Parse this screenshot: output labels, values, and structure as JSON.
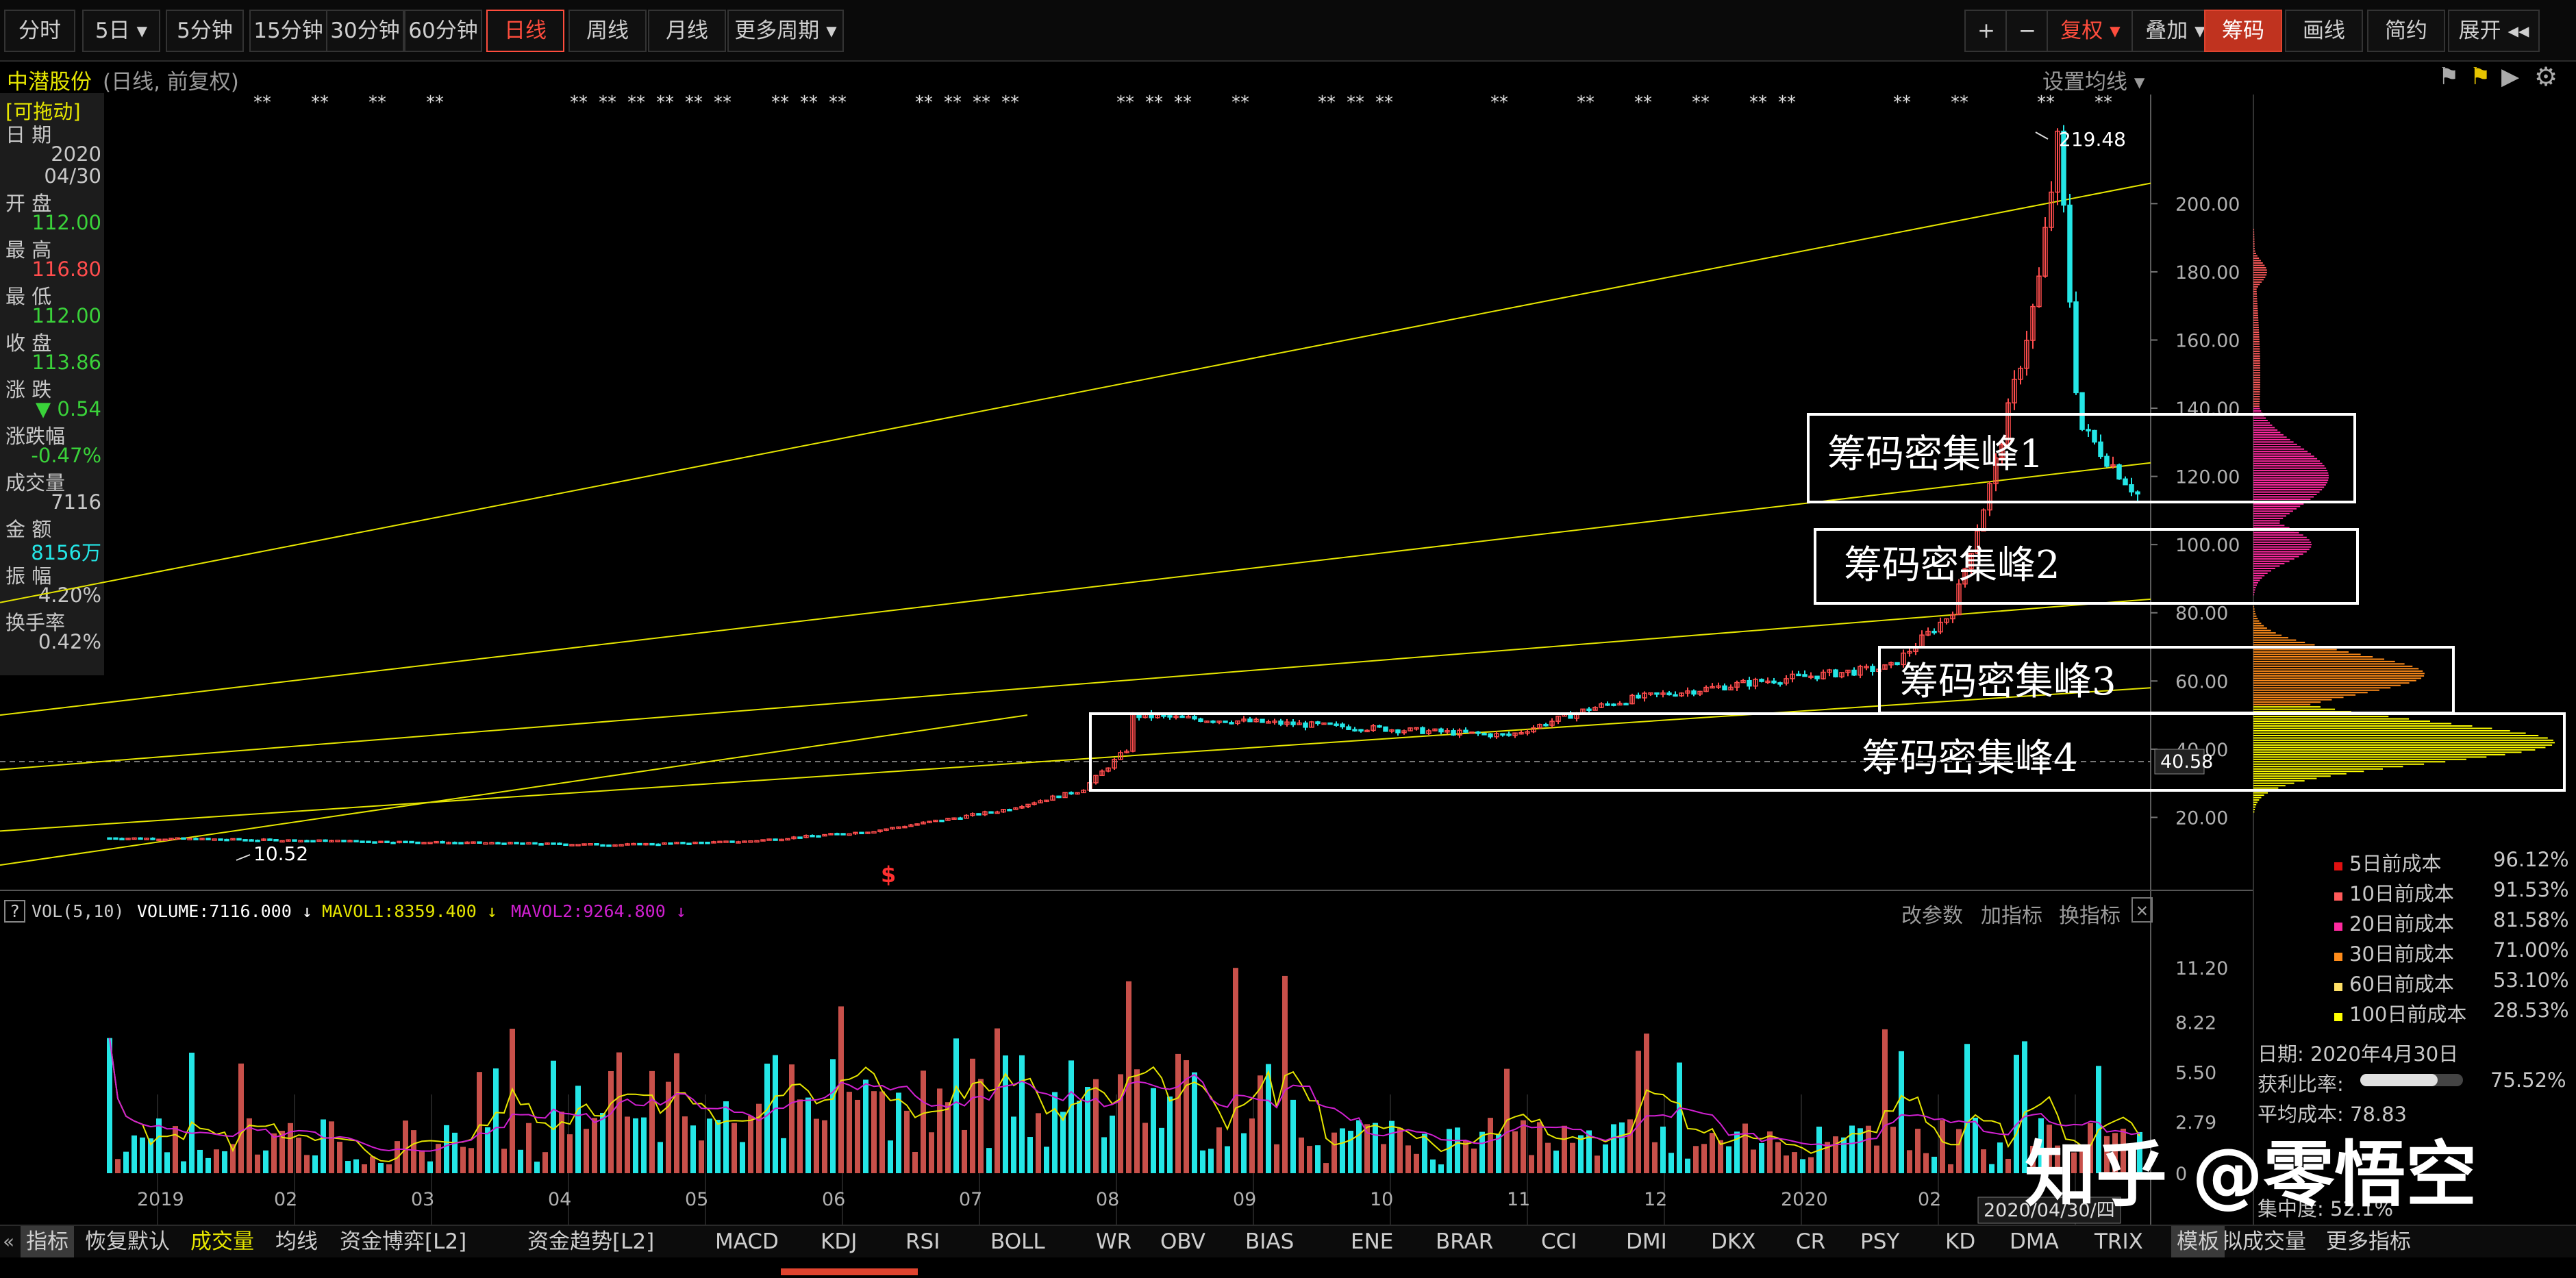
{
  "toolbar": {
    "left_tabs": [
      "分时",
      "5日 ▾",
      "5分钟",
      "15分钟",
      "30分钟",
      "60分钟",
      "日线",
      "周线",
      "月线",
      "更多周期 ▾"
    ],
    "right_tabs": [
      "+",
      "−",
      "复权 ▾",
      "叠加 ▾",
      "筹码",
      "画线",
      "简约",
      "展开 ◂◂"
    ]
  },
  "header": {
    "stock_name": "中潜股份",
    "mode": "(日线, 前复权)",
    "ma_settings": "设置均线 ▾"
  },
  "info_panel": [
    {
      "label": "[可拖动]",
      "value": ""
    },
    {
      "label": "日  期",
      "value": "2020"
    },
    {
      "label": "",
      "value": "04/30"
    },
    {
      "label": "开  盘",
      "value": "112.00"
    },
    {
      "label": "最  高",
      "value": "116.80"
    },
    {
      "label": "最  低",
      "value": "112.00"
    },
    {
      "label": "收  盘",
      "value": "113.86"
    },
    {
      "label": "涨  跌",
      "value": "▼ 0.54"
    },
    {
      "label": "涨跌幅",
      "value": "-0.47%"
    },
    {
      "label": "成交量",
      "value": "7116"
    },
    {
      "label": "金  额",
      "value": "8156万"
    },
    {
      "label": "振  幅",
      "value": "4.20%"
    },
    {
      "label": "换手率",
      "value": "0.42%"
    }
  ],
  "annotations": {
    "peaks": [
      "筹码密集峰1",
      "筹码密集峰2",
      "筹码密集峰3",
      "筹码密集峰4"
    ],
    "high_label": "219.48",
    "low_label": "10.52",
    "current_price": "40.58",
    "signal_marker": "$"
  },
  "volume_header": {
    "title": "VOL(5,10)",
    "volume": "VOLUME:7116.000 ↓",
    "mavol1": "MAVOL1:8359.400 ↓",
    "mavol2": "MAVOL2:9264.800 ↓",
    "actions": [
      "改参数",
      "加指标",
      "换指标"
    ]
  },
  "date_cursor": "2020/04/30/四",
  "watermark": "知乎 @零悟空",
  "cost_legend": [
    {
      "label": "5日前成本",
      "value": "96.12%",
      "color": "#e01010"
    },
    {
      "label": "10日前成本",
      "value": "91.53%",
      "color": "#ff5a5a"
    },
    {
      "label": "20日前成本",
      "value": "81.58%",
      "color": "#ff2aa0"
    },
    {
      "label": "30日前成本",
      "value": "71.00%",
      "color": "#ff8c1a"
    },
    {
      "label": "60日前成本",
      "value": "53.10%",
      "color": "#ffe066"
    },
    {
      "label": "100日前成本",
      "value": "28.53%",
      "color": "#ffff00"
    }
  ],
  "chip_summary": {
    "date": "日期: 2020年4月30日",
    "profit_label": "获利比率:",
    "profit_value": "75.52%",
    "avg_cost": "平均成本: 78.83",
    "concentration": "集中度: 52.1%"
  },
  "bottom_tabs": [
    "指标",
    "恢复默认",
    "成交量",
    "均线",
    "资金博弈[L2]",
    "资金趋势[L2]",
    "MACD",
    "KDJ",
    "RSI",
    "BOLL",
    "WR",
    "OBV",
    "BIAS",
    "ENE",
    "BRAR",
    "CCI",
    "DMI",
    "DKX",
    "CR",
    "PSY",
    "KD",
    "DMA",
    "TRIX",
    "虚拟成交量",
    "更多指标",
    "模板"
  ],
  "colors": {
    "up": "#ff4d4d",
    "down": "#24e6e6",
    "trend": "#e6e600",
    "mavol1": "#e6e600",
    "mavol2": "#d020d0"
  },
  "chart_data": {
    "type": "candlestick",
    "stock": "中潜股份",
    "period": "日线",
    "y_axis_ticks": [
      "200.00",
      "180.00",
      "160.00",
      "140.00",
      "120.00",
      "100.00",
      "80.00",
      "60.00",
      "40.00",
      "20.00"
    ],
    "ylim": [
      0,
      230
    ],
    "x_axis_ticks": [
      "2019",
      "02",
      "03",
      "04",
      "05",
      "06",
      "07",
      "08",
      "09",
      "10",
      "11",
      "12",
      "2020",
      "02",
      "03"
    ],
    "price_path": [
      {
        "date": "2019-01",
        "close": 14
      },
      {
        "date": "2019-02",
        "close": 13.5
      },
      {
        "date": "2019-03",
        "close": 13
      },
      {
        "date": "2019-04",
        "close": 12.5
      },
      {
        "date": "2019-05",
        "close": 12
      },
      {
        "date": "2019-06",
        "close": 13
      },
      {
        "date": "2019-07",
        "close": 16
      },
      {
        "date": "2019-08",
        "close": 22
      },
      {
        "date": "2019-08-20",
        "close": 28
      },
      {
        "date": "2019-08-31",
        "close": 40
      },
      {
        "date": "2019-09",
        "close": 50
      },
      {
        "date": "2019-10",
        "close": 48
      },
      {
        "date": "2019-11",
        "close": 46
      },
      {
        "date": "2019-12",
        "close": 44
      },
      {
        "date": "2019-12-20",
        "close": 52
      },
      {
        "date": "2020-01",
        "close": 55
      },
      {
        "date": "2020-02",
        "close": 60
      },
      {
        "date": "2020-03",
        "close": 64
      },
      {
        "date": "2020-03-15",
        "close": 80
      },
      {
        "date": "2020-03-25",
        "close": 120
      },
      {
        "date": "2020-04-05",
        "close": 175
      },
      {
        "date": "2020-04-10",
        "close": 219.48
      },
      {
        "date": "2020-04-15",
        "close": 135
      },
      {
        "date": "2020-04-30",
        "close": 113.86
      }
    ],
    "chip_peaks": [
      {
        "name": "筹码密集峰1",
        "price": 120
      },
      {
        "name": "筹码密集峰2",
        "price": 100
      },
      {
        "name": "筹码密集峰3",
        "price": 60
      },
      {
        "name": "筹码密集峰4",
        "price": 40
      }
    ],
    "volume_axis_ticks": [
      "11.20",
      "8.22",
      "5.50",
      "2.79",
      "0"
    ],
    "volume_ylim": [
      0,
      12.5
    ],
    "last_volume": 7116
  }
}
